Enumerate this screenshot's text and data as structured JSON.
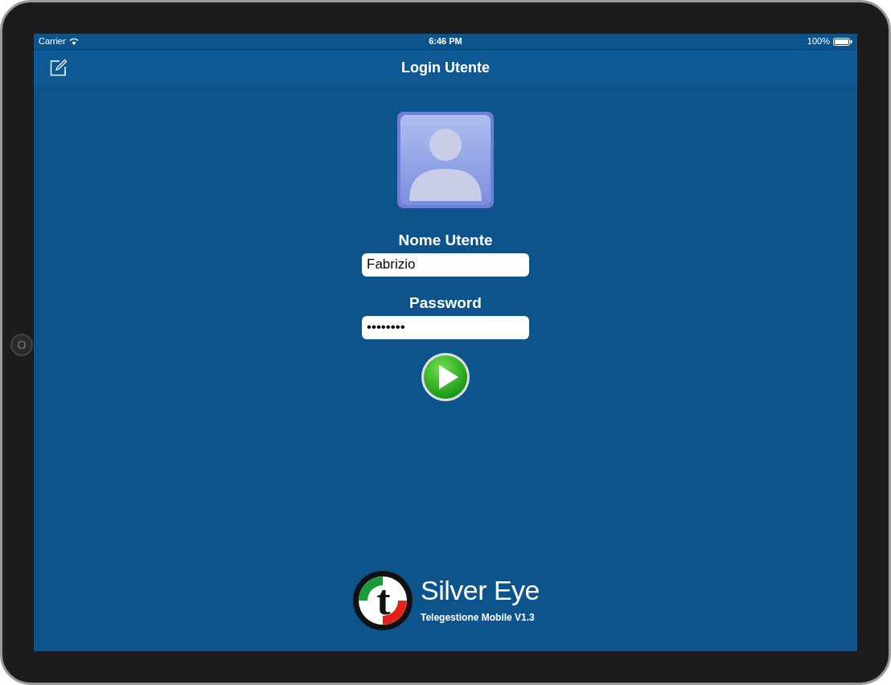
{
  "status_bar": {
    "carrier": "Carrier",
    "time": "6:46 PM",
    "battery": "100%"
  },
  "nav_bar": {
    "title": "Login Utente"
  },
  "form": {
    "fields": [
      {
        "label": "Nome Utente",
        "value": "Fabrizio"
      },
      {
        "label": "Password",
        "value": "••••••••"
      }
    ]
  },
  "logo": {
    "letter": "t",
    "title": "Silver Eye",
    "subtitle": "Telegestione Mobile V1.3"
  }
}
